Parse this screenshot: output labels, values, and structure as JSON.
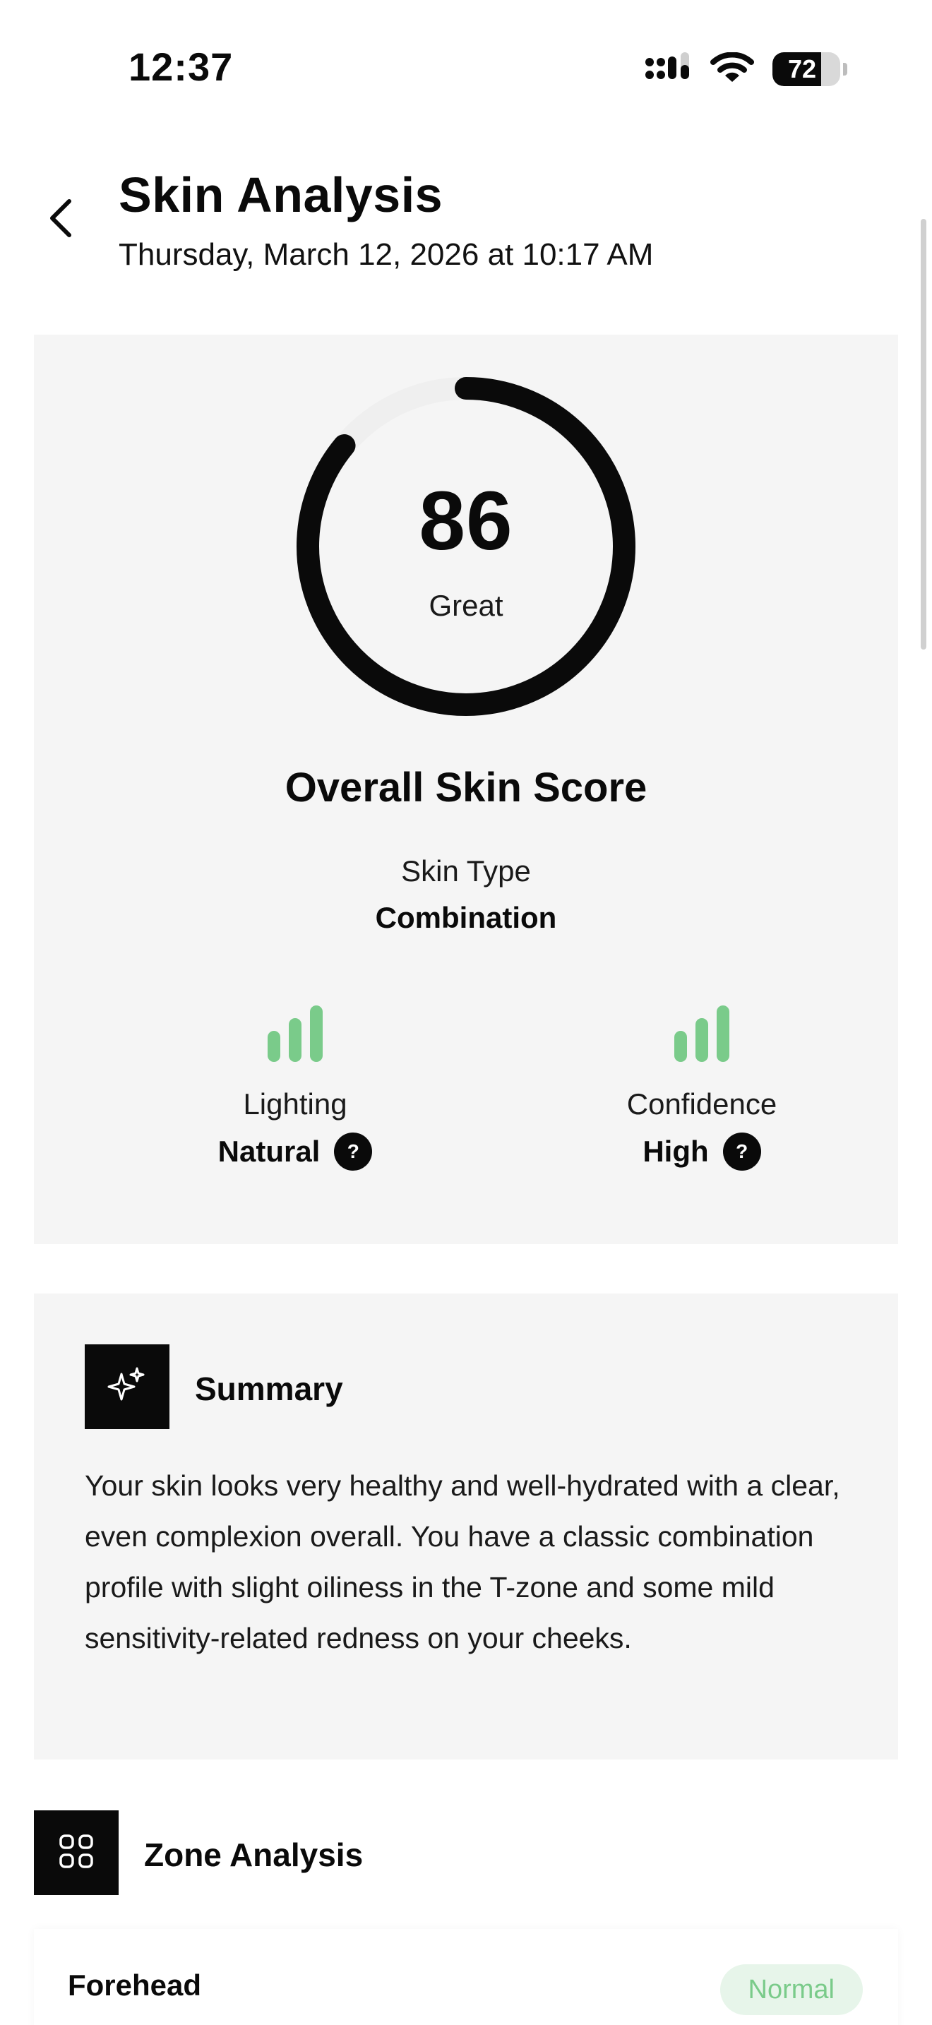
{
  "status_bar": {
    "time": "12:37",
    "battery_percent": "72",
    "icons": [
      "cellular-signal-icon",
      "wifi-icon",
      "battery-icon"
    ]
  },
  "header": {
    "back_icon": "chevron-left-icon",
    "title": "Skin Analysis",
    "subtitle": "Thursday, March 12, 2026 at 10:17 AM"
  },
  "score_card": {
    "score": "86",
    "score_fraction": 0.86,
    "rating": "Great",
    "overall_title": "Overall Skin Score",
    "skin_type_label": "Skin Type",
    "skin_type_value": "Combination",
    "metrics": [
      {
        "label": "Lighting",
        "value": "Natural",
        "level": 3,
        "icon": "signal-bars-icon"
      },
      {
        "label": "Confidence",
        "value": "High",
        "level": 3,
        "icon": "signal-bars-icon"
      }
    ],
    "help_glyph": "?"
  },
  "summary": {
    "icon": "sparkles-icon",
    "title": "Summary",
    "text": "Your skin looks very healthy and well-hydrated with a clear, even complexion overall. You have a classic combination profile with slight oiliness in the T-zone and some mild sensitivity-related redness on your cheeks."
  },
  "zone_analysis": {
    "icon": "grid-icon",
    "title": "Zone Analysis",
    "zones": [
      {
        "name": "Forehead",
        "status": "Normal"
      }
    ]
  },
  "colors": {
    "accent_green": "#7acb8a",
    "badge_bg": "#e7f5ea",
    "card_bg": "#f5f5f5",
    "ring_track": "#efefef",
    "ring_fill": "#0a0a0a"
  }
}
